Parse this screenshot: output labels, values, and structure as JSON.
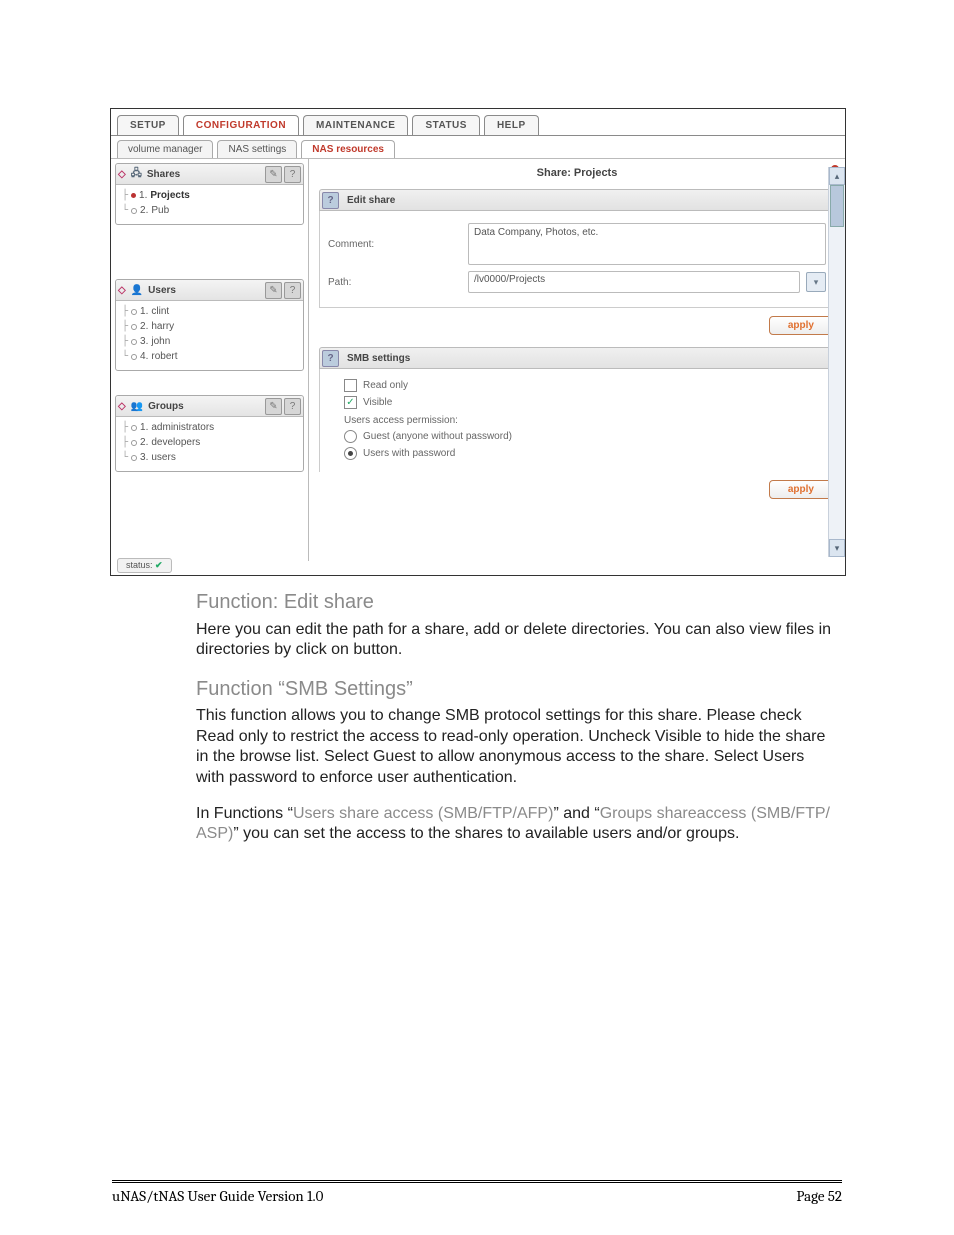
{
  "tabs": {
    "setup": "SETUP",
    "configuration": "CONFIGURATION",
    "maintenance": "MAINTENANCE",
    "status": "STATUS",
    "help": "HELP"
  },
  "subtabs": {
    "volume": "volume manager",
    "nas_settings": "NAS settings",
    "nas_resources": "NAS resources"
  },
  "sidebar": {
    "shares": {
      "title": "Shares",
      "items": [
        {
          "n": "1.",
          "label": "Projects",
          "active": true
        },
        {
          "n": "2.",
          "label": "Pub",
          "active": false
        }
      ]
    },
    "users": {
      "title": "Users",
      "items": [
        {
          "n": "1.",
          "label": "clint"
        },
        {
          "n": "2.",
          "label": "harry"
        },
        {
          "n": "3.",
          "label": "john"
        },
        {
          "n": "4.",
          "label": "robert"
        }
      ]
    },
    "groups": {
      "title": "Groups",
      "items": [
        {
          "n": "1.",
          "label": "administrators"
        },
        {
          "n": "2.",
          "label": "developers"
        },
        {
          "n": "3.",
          "label": "users"
        }
      ]
    }
  },
  "main": {
    "share_title": "Share: Projects",
    "edit": {
      "title": "Edit share",
      "comment_label": "Comment:",
      "comment_value": "Data Company, Photos, etc.",
      "path_label": "Path:",
      "path_value": "/lv0000/Projects",
      "apply": "apply"
    },
    "smb": {
      "title": "SMB settings",
      "read_only": "Read only",
      "read_only_checked": false,
      "visible": "Visible",
      "visible_checked": true,
      "perm_label": "Users access permission:",
      "guest": "Guest (anyone without password)",
      "guest_selected": false,
      "users_pw": "Users with password",
      "users_pw_selected": true,
      "apply": "apply"
    }
  },
  "status": {
    "label": "status:",
    "ok": "✔"
  },
  "help_q": "?",
  "doc": {
    "h1": "Function: Edit share",
    "p1": "Here you can edit the path for a share, add or delete directories. You can also view files in directories by click on button.",
    "h2": "Function “SMB Settings”",
    "p2": "This function allows you to change SMB protocol settings for this share. Please check Read only to restrict the access to read-only operation. Uncheck Visible to hide the share in the browse list. Select Guest to allow anonymous access to the share. Select Users with password to enforce user authentication.",
    "p3a": "In Functions “",
    "p3b": "Users share access (SMB/FTP/AFP)",
    "p3c": "” and “",
    "p3d": "Groups shareaccess (SMB/FTP/ ASP)",
    "p3e": "” you can set the access to the shares to available users and/or groups."
  },
  "footer": {
    "left": "uNAS/tNAS User Guide Version 1.0",
    "right": "Page 52"
  }
}
